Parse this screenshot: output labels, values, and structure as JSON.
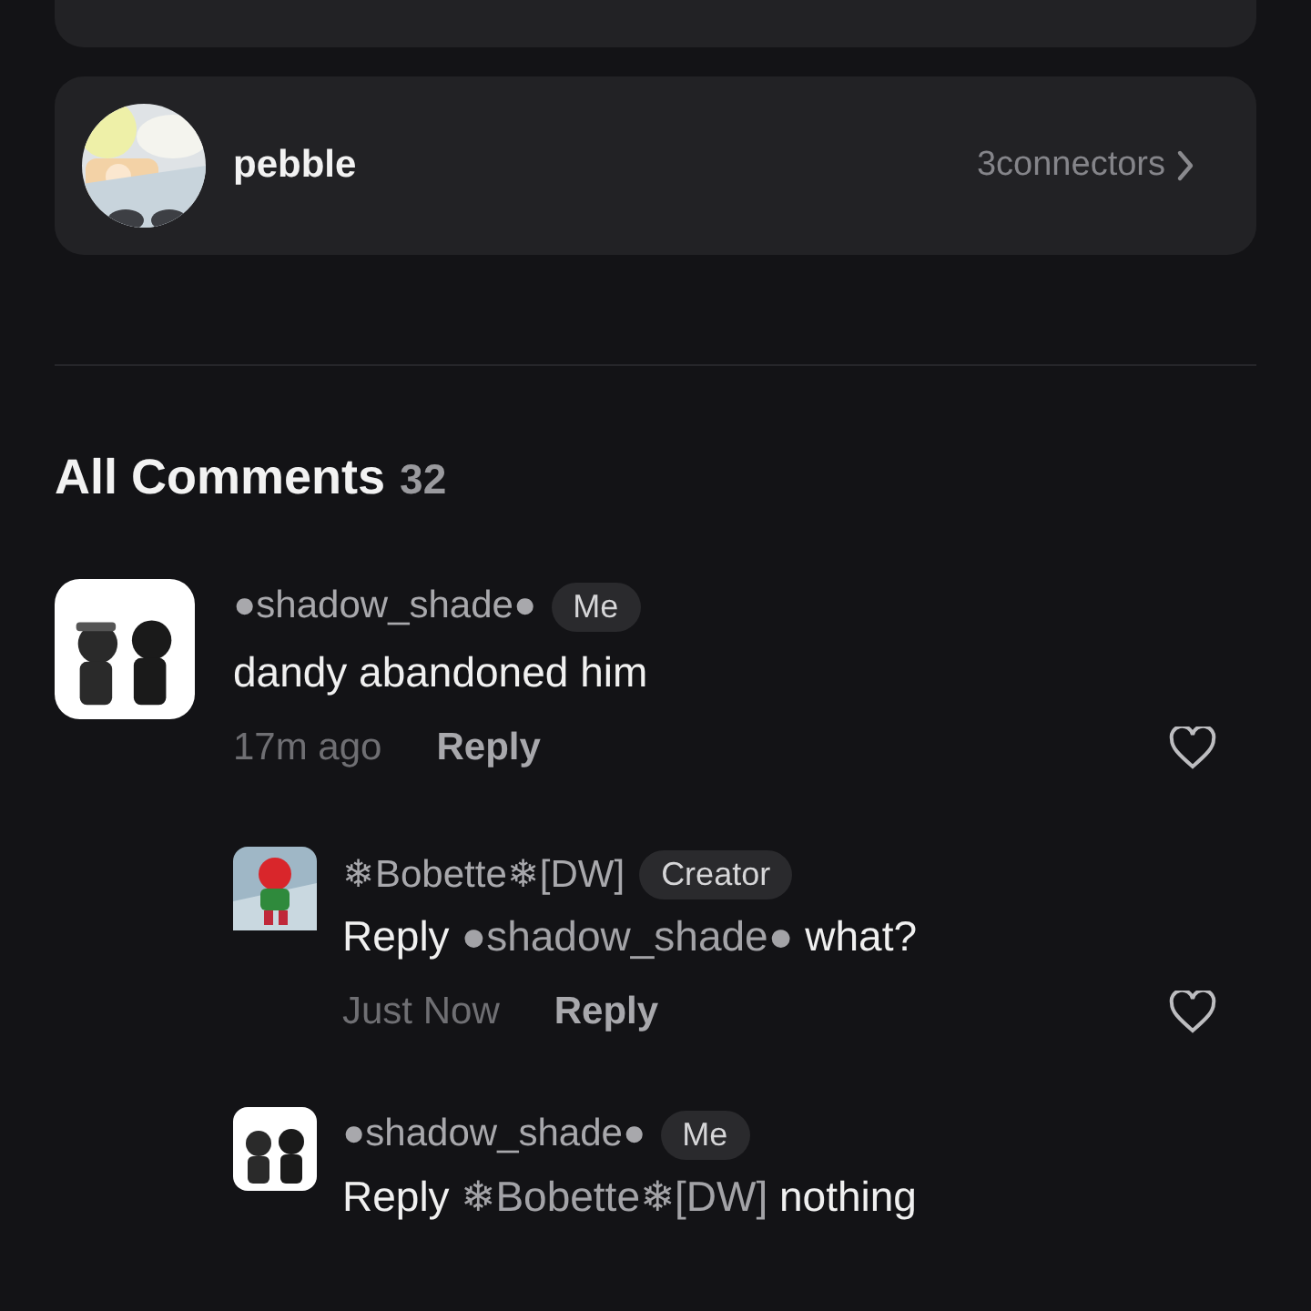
{
  "group_card": {
    "name": "pebble",
    "connectors": "3connectors"
  },
  "comments_header": {
    "title": "All Comments",
    "count": "32"
  },
  "comments": [
    {
      "author": "●shadow_shade●",
      "badge": "Me",
      "text": "dandy abandoned him",
      "time": "17m ago",
      "reply_label": "Reply",
      "replies": [
        {
          "author": "❄Bobette❄[DW]",
          "badge": "Creator",
          "reply_prefix": "Reply",
          "mention": "●shadow_shade●",
          "text": "what?",
          "time": "Just Now",
          "reply_label": "Reply"
        },
        {
          "author": "●shadow_shade●",
          "badge": "Me",
          "reply_prefix": "Reply",
          "mention": "❄Bobette❄[DW]",
          "text": "nothing"
        }
      ]
    }
  ]
}
